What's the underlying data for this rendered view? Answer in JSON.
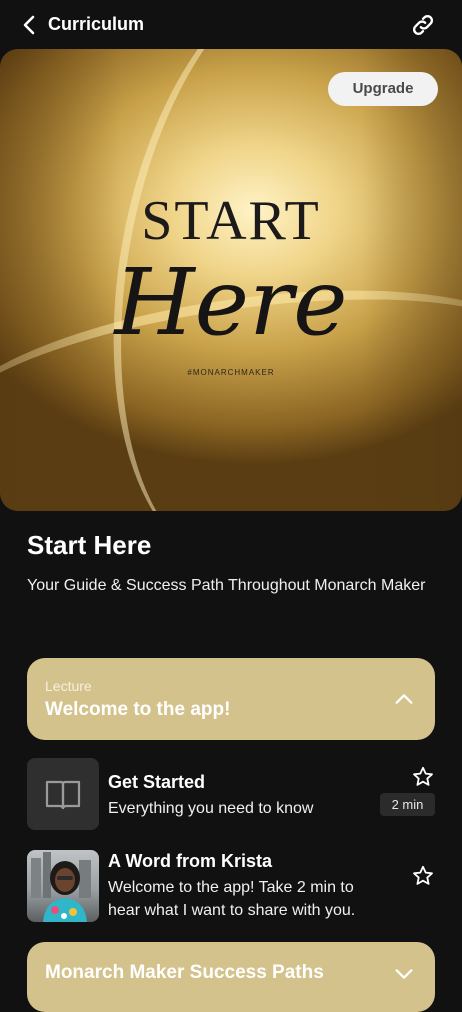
{
  "header": {
    "title": "Curriculum",
    "back_icon": "chevron-left-icon",
    "link_icon": "link-icon"
  },
  "hero": {
    "word_start": "START",
    "word_here": "Here",
    "hashtag": "#MONARCHMAKER",
    "upgrade_label": "Upgrade"
  },
  "course": {
    "title": "Start Here",
    "subtitle": "Your Guide & Success Path Throughout Monarch Maker"
  },
  "sections": [
    {
      "kicker": "Lecture",
      "title": "Welcome to the app!",
      "expanded": true,
      "icon": "chevron-up-icon",
      "items": [
        {
          "title": "Get Started",
          "description": "Everything you need to know",
          "duration": "2 min",
          "thumb_icon": "book-icon",
          "star_icon": "star-outline-icon"
        },
        {
          "title": "A Word from Krista",
          "description": "Welcome to the app! Take 2 min to hear what I want to share with you.",
          "thumb_icon": "avatar-photo",
          "star_icon": "star-outline-icon"
        }
      ]
    },
    {
      "title": "Monarch Maker Success Paths",
      "expanded": false,
      "icon": "chevron-down-icon"
    }
  ],
  "colors": {
    "background": "#111111",
    "card": "#d4c28c",
    "accent_gold": "#c9a24a"
  }
}
